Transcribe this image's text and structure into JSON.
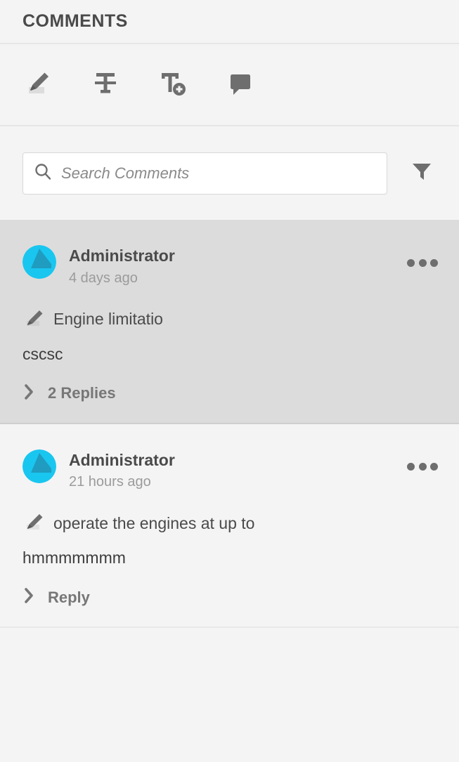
{
  "header": {
    "title": "COMMENTS"
  },
  "toolbar": {
    "tools": [
      {
        "name": "highlight-text-tool",
        "label": "Highlight Text"
      },
      {
        "name": "strikethrough-text-tool",
        "label": "Strikethrough Text"
      },
      {
        "name": "add-text-tool",
        "label": "Add Text Comment"
      },
      {
        "name": "sticky-note-tool",
        "label": "Add Sticky Note"
      }
    ]
  },
  "search": {
    "placeholder": "Search Comments",
    "value": "",
    "icon": "search-icon",
    "filter_icon": "filter-funnel-icon"
  },
  "colors": {
    "panel_background": "#f4f4f4",
    "selected_background": "#dcdcdc",
    "avatar_primary": "#19c6f0",
    "avatar_secondary": "#1f9cc0",
    "text_primary": "#4a4a4a",
    "text_muted": "#9b9b9b",
    "divider": "#e6e6e6"
  },
  "comments": [
    {
      "author": "Administrator",
      "timestamp": "4 days ago",
      "quote": "Engine limitatio",
      "body": "cscsc",
      "replies_label": "2 Replies",
      "replies_count": 2,
      "selected": true,
      "annotation_icon": "highlighter-icon",
      "more_icon": "ellipsis-icon"
    },
    {
      "author": "Administrator",
      "timestamp": "21 hours ago",
      "quote": "operate the engines at up to",
      "body": "hmmmmmmm",
      "replies_label": "Reply",
      "replies_count": 0,
      "selected": false,
      "annotation_icon": "highlighter-icon",
      "more_icon": "ellipsis-icon"
    }
  ]
}
